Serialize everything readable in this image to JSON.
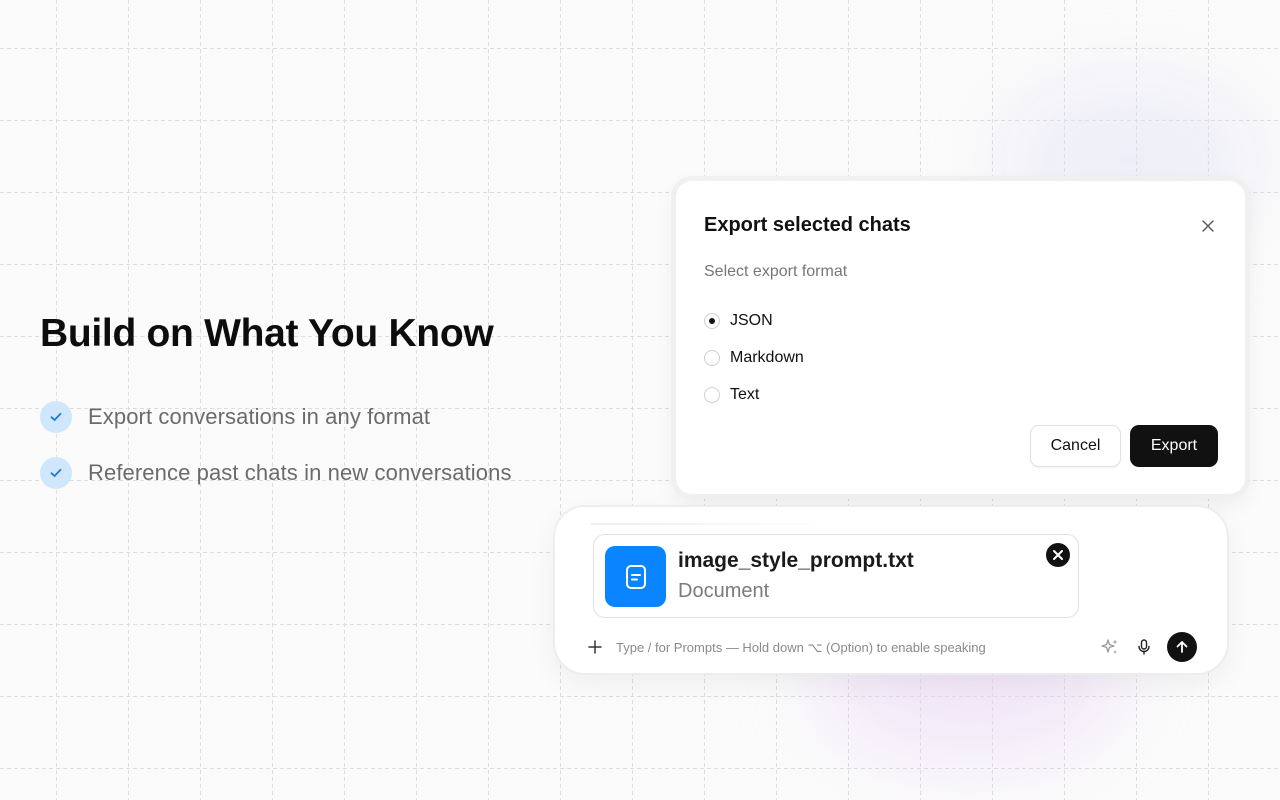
{
  "hero": {
    "title": "Build on What You Know",
    "features": [
      "Export conversations in any format",
      "Reference past chats in new conversations"
    ]
  },
  "export_dialog": {
    "title": "Export selected chats",
    "subtitle": "Select export format",
    "options": [
      "JSON",
      "Markdown",
      "Text"
    ],
    "selected": "JSON",
    "cancel_label": "Cancel",
    "export_label": "Export"
  },
  "composer": {
    "attachment": {
      "name": "image_style_prompt.txt",
      "type": "Document",
      "icon": "document-icon"
    },
    "placeholder": "Type / for Prompts — Hold down ⌥ (Option) to enable speaking",
    "icons": [
      "plus-icon",
      "sparkle-icon",
      "microphone-icon",
      "arrow-up-icon"
    ]
  },
  "colors": {
    "accent_blue": "#0a84ff",
    "check_bg": "#cfe6fb",
    "check_fg": "#1f7ad6",
    "primary_button": "#111111"
  }
}
